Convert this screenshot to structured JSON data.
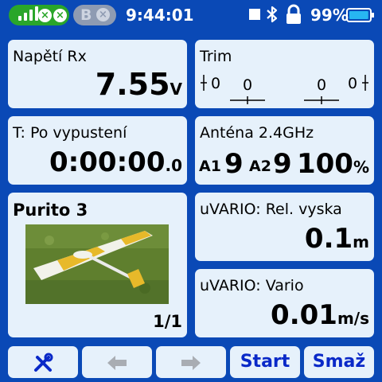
{
  "status": {
    "time": "9:44:01",
    "battery_percent": "99%",
    "module_b_label": "B",
    "signal_icon": "signal-bars-icon",
    "bluetooth_icon": "bluetooth-icon",
    "lock_icon": "lock-icon",
    "battery_icon": "battery-icon",
    "battery_level": 0.99,
    "accent_color": "#0a49b6"
  },
  "widgets": {
    "rx_voltage": {
      "label": "Napětí Rx",
      "value": "7.55",
      "unit": "V"
    },
    "trim": {
      "label": "Trim",
      "values": [
        "0",
        "0",
        "0",
        "0"
      ]
    },
    "timer": {
      "label": "T: Po vypustení",
      "value": "0:00:00",
      "fraction": ".0"
    },
    "antenna": {
      "label": "Anténa 2.4GHz",
      "a1_label": "A1",
      "a1_value": "9",
      "a2_label": "A2",
      "a2_value": "9",
      "percent": "100",
      "percent_unit": "%"
    },
    "model": {
      "name": "Purito 3",
      "page": "1/1"
    },
    "vario_alt": {
      "label": "uVARIO: Rel. vyska",
      "value": "0.1",
      "unit": "m"
    },
    "vario": {
      "label": "uVARIO: Vario",
      "value": "0.01",
      "unit": "m/s"
    }
  },
  "toolbar": {
    "settings_icon": "tools-icon",
    "prev_icon": "arrow-left-icon",
    "next_icon": "arrow-right-icon",
    "start_label": "Start",
    "clear_label": "Smaž"
  }
}
